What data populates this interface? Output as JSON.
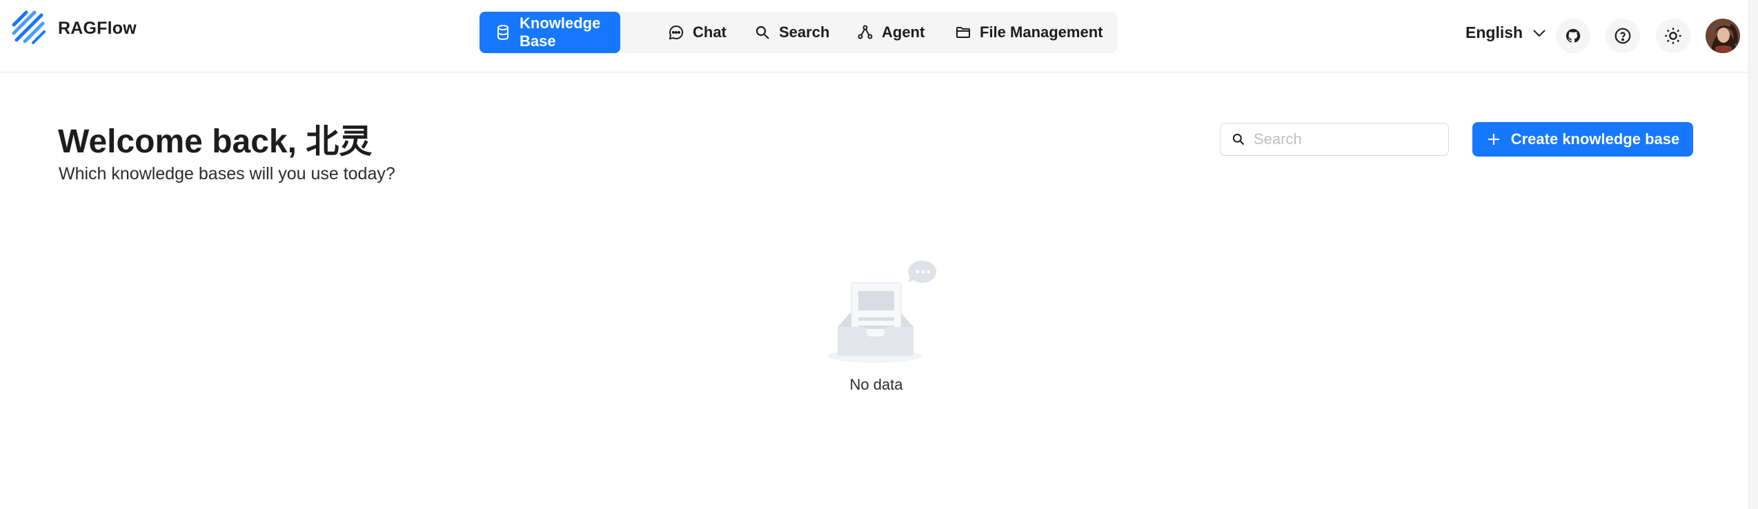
{
  "brand": {
    "name": "RAGFlow",
    "logo_icon": "ragflow-logo-icon"
  },
  "nav": {
    "items": [
      {
        "label": "Knowledge Base",
        "icon": "database-icon",
        "active": true
      },
      {
        "label": "Chat",
        "icon": "chat-bubble-icon",
        "active": false
      },
      {
        "label": "Search",
        "icon": "search-icon",
        "active": false
      },
      {
        "label": "Agent",
        "icon": "agent-graph-icon",
        "active": false
      },
      {
        "label": "File Management",
        "icon": "folder-icon",
        "active": false
      }
    ]
  },
  "header_right": {
    "language": "English",
    "icons": [
      "github-icon",
      "help-icon",
      "theme-sun-icon"
    ],
    "avatar": "user-avatar"
  },
  "main": {
    "welcome": "Welcome back, 北灵",
    "subtitle": "Which knowledge bases will you use today?",
    "search_placeholder": "Search",
    "create_label": "Create knowledge base",
    "empty_text": "No data"
  },
  "colors": {
    "accent": "#1677ff",
    "nav_bg": "#f5f5f6"
  }
}
